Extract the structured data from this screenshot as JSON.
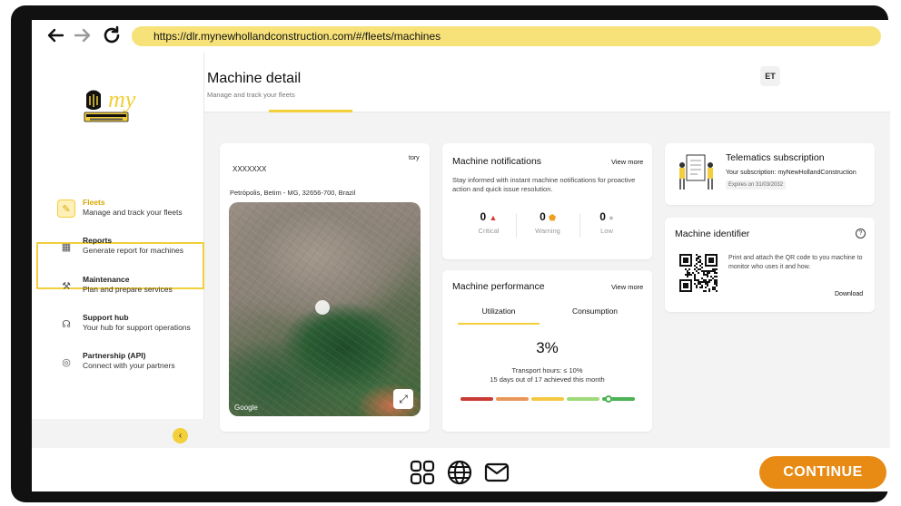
{
  "browser": {
    "url": "https://dlr.mynewhollandconstruction.com/#/fleets/machines"
  },
  "sidebar": {
    "items": [
      {
        "title": "Fleets",
        "subtitle": "Manage and track your fleets"
      },
      {
        "title": "Reports",
        "subtitle": "Generate report for machines"
      },
      {
        "title": "Maintenance",
        "subtitle": "Plan and prepare services"
      },
      {
        "title": "Support hub",
        "subtitle": "Your hub for support operations"
      },
      {
        "title": "Partnership (API)",
        "subtitle": "Connect with your partners"
      }
    ],
    "collapse": "‹"
  },
  "header": {
    "title": "Machine detail",
    "subtitle": "Manage and track your fleets",
    "avatar": "ET"
  },
  "machine_card": {
    "tag": "tory",
    "name": "XXXXXXX",
    "address": "Petrópolis, Betim - MG, 32656-700, Brazil",
    "map_mark": "Google"
  },
  "notifications": {
    "title": "Machine notifications",
    "view_more": "View more",
    "description": "Stay informed with instant machine notifications for proactive action and quick issue resolution.",
    "counts": [
      {
        "value": "0",
        "label": "Critical",
        "color": "#d63a2f"
      },
      {
        "value": "0",
        "label": "Warning",
        "color": "#f0a020"
      },
      {
        "value": "0",
        "label": "Low",
        "color": "#bbbbbb"
      }
    ]
  },
  "performance": {
    "title": "Machine performance",
    "view_more": "View more",
    "tabs": [
      "Utilization",
      "Consumption"
    ],
    "active_tab": "Utilization",
    "value": "3%",
    "line1": "Transport hours: ≤ 10%",
    "line2": "15 days out of 17 achieved this month",
    "scale_colors": [
      "#c93a32",
      "#e9965a",
      "#f2c842",
      "#9ed97a",
      "#4bb352"
    ],
    "marker_fraction": 0.85
  },
  "telematics": {
    "title": "Telematics subscription",
    "subscription_label": "Your subscription:",
    "subscription_value": "myNewHollandConstruction",
    "expires": "Expires on 31/03/2032"
  },
  "identifier": {
    "title": "Machine identifier",
    "help": "?",
    "description": "Print and attach the QR code to you machine to monitor who uses it and how.",
    "download": "Download"
  },
  "footer": {
    "continue_label": "CONTINUE"
  },
  "colors": {
    "accent": "#f2cf3b",
    "continue": "#e88b15"
  }
}
